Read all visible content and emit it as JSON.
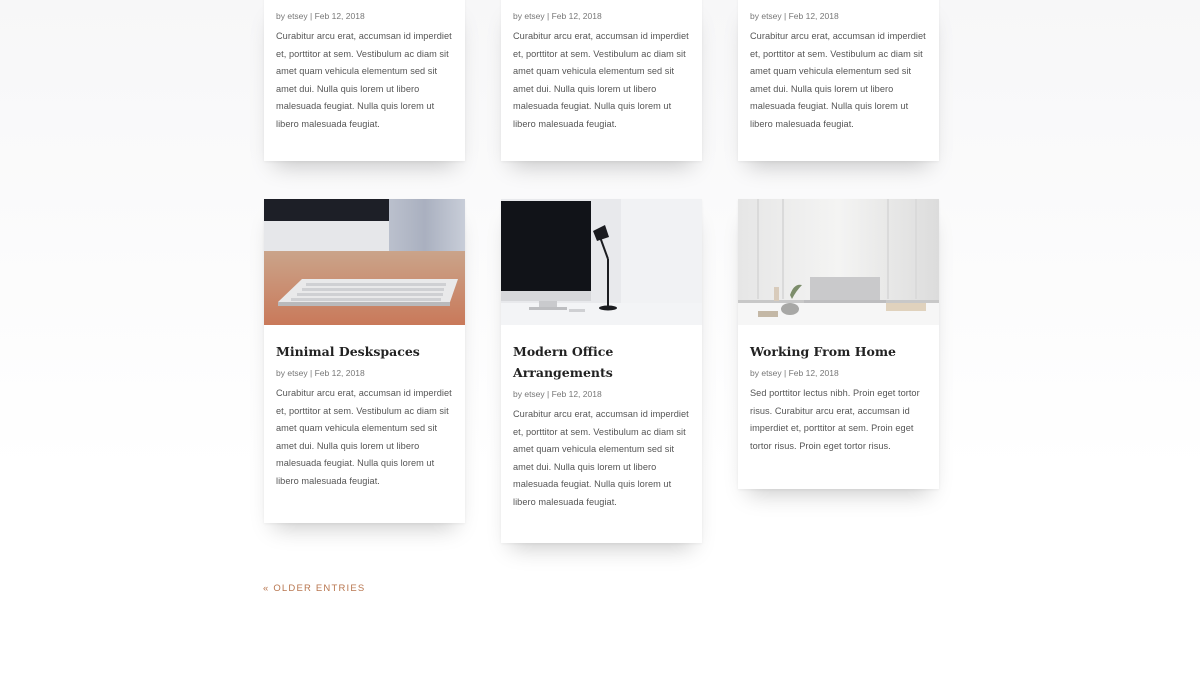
{
  "posts_top": [
    {
      "meta": "by etsey | Feb 12, 2018",
      "excerpt": "Curabitur arcu erat, accumsan id imperdiet et, porttitor at sem. Vestibulum ac diam sit amet quam vehicula elementum sed sit amet dui. Nulla quis lorem ut libero malesuada feugiat. Nulla quis lorem ut libero malesuada feugiat."
    },
    {
      "meta": "by etsey | Feb 12, 2018",
      "excerpt": "Curabitur arcu erat, accumsan id imperdiet et, porttitor at sem. Vestibulum ac diam sit amet quam vehicula elementum sed sit amet dui. Nulla quis lorem ut libero malesuada feugiat. Nulla quis lorem ut libero malesuada feugiat."
    },
    {
      "meta": "by etsey | Feb 12, 2018",
      "excerpt": "Curabitur arcu erat, accumsan id imperdiet et, porttitor at sem. Vestibulum ac diam sit amet quam vehicula elementum sed sit amet dui. Nulla quis lorem ut libero malesuada feugiat. Nulla quis lorem ut libero malesuada feugiat."
    }
  ],
  "posts_bottom": [
    {
      "title": "Minimal Deskspaces",
      "meta": "by etsey | Feb 12, 2018",
      "excerpt": "Curabitur arcu erat, accumsan id imperdiet et, porttitor at sem. Vestibulum ac diam sit amet quam vehicula elementum sed sit amet dui. Nulla quis lorem ut libero malesuada feugiat. Nulla quis lorem ut libero malesuada feugiat."
    },
    {
      "title": "Modern Office Arrangements",
      "meta": "by etsey | Feb 12, 2018",
      "excerpt": "Curabitur arcu erat, accumsan id imperdiet et, porttitor at sem. Vestibulum ac diam sit amet quam vehicula elementum sed sit amet dui. Nulla quis lorem ut libero malesuada feugiat. Nulla quis lorem ut libero malesuada feugiat."
    },
    {
      "title": "Working From Home",
      "meta": "by etsey | Feb 12, 2018",
      "excerpt": "Sed porttitor lectus nibh. Proin eget tortor risus. Curabitur arcu erat, accumsan id imperdiet et, porttitor at sem. Proin eget tortor risus. Proin eget tortor risus."
    }
  ],
  "pagination": {
    "older_label": "« Older Entries"
  },
  "colors": {
    "accent": "#b8764f",
    "title": "#222222",
    "text": "#555555"
  }
}
